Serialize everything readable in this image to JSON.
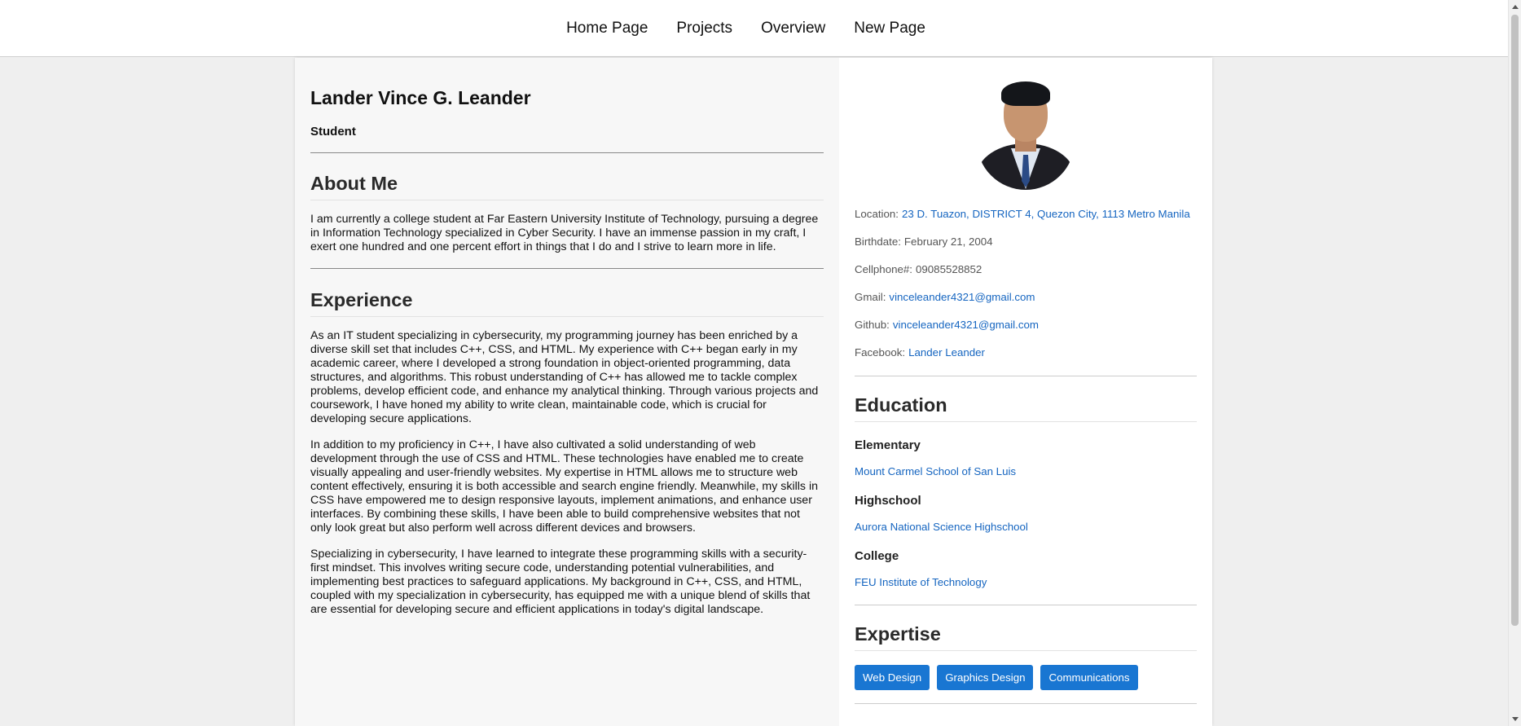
{
  "nav": {
    "items": [
      "Home Page",
      "Projects",
      "Overview",
      "New Page"
    ]
  },
  "profile": {
    "name": "Lander Vince G. Leander",
    "role": "Student",
    "about_title": "About Me",
    "about_text": "I am currently a college student at Far Eastern University Institute of Technology, pursuing a degree in Information Technology specialized in Cyber Security. I have an immense passion in my craft, I exert one hundred and one percent effort in things that I do and I strive to learn more in life.",
    "experience_title": "Experience",
    "experience_paragraphs": [
      "As an IT student specializing in cybersecurity, my programming journey has been enriched by a diverse skill set that includes C++, CSS, and HTML. My experience with C++ began early in my academic career, where I developed a strong foundation in object-oriented programming, data structures, and algorithms. This robust understanding of C++ has allowed me to tackle complex problems, develop efficient code, and enhance my analytical thinking. Through various projects and coursework, I have honed my ability to write clean, maintainable code, which is crucial for developing secure applications.",
      "In addition to my proficiency in C++, I have also cultivated a solid understanding of web development through the use of CSS and HTML. These technologies have enabled me to create visually appealing and user-friendly websites. My expertise in HTML allows me to structure web content effectively, ensuring it is both accessible and search engine friendly. Meanwhile, my skills in CSS have empowered me to design responsive layouts, implement animations, and enhance user interfaces. By combining these skills, I have been able to build comprehensive websites that not only look great but also perform well across different devices and browsers.",
      "Specializing in cybersecurity, I have learned to integrate these programming skills with a security-first mindset. This involves writing secure code, understanding potential vulnerabilities, and implementing best practices to safeguard applications. My background in C++, CSS, and HTML, coupled with my specialization in cybersecurity, has equipped me with a unique blend of skills that are essential for developing secure and efficient applications in today's digital landscape."
    ]
  },
  "contact": {
    "location_label": "Location:",
    "location_value": "23 D. Tuazon, DISTRICT 4, Quezon City, 1113 Metro Manila",
    "birthdate_label": "Birthdate:",
    "birthdate_value": "February 21, 2004",
    "cellphone_label": "Cellphone#:",
    "cellphone_value": "09085528852",
    "gmail_label": "Gmail:",
    "gmail_value": "vinceleander4321@gmail.com",
    "github_label": "Github:",
    "github_value": "vinceleander4321@gmail.com",
    "facebook_label": "Facebook:",
    "facebook_value": "Lander Leander"
  },
  "education": {
    "title": "Education",
    "entries": [
      {
        "level": "Elementary",
        "school": "Mount Carmel School of San Luis"
      },
      {
        "level": "Highschool",
        "school": "Aurora National Science Highschool"
      },
      {
        "level": "College",
        "school": "FEU Institute of Technology"
      }
    ]
  },
  "expertise": {
    "title": "Expertise",
    "tags": [
      "Web Design",
      "Graphics Design",
      "Communications"
    ]
  },
  "colors": {
    "link": "#1565c0",
    "tag_bg": "#1976d2",
    "page_bg": "#efefef"
  }
}
